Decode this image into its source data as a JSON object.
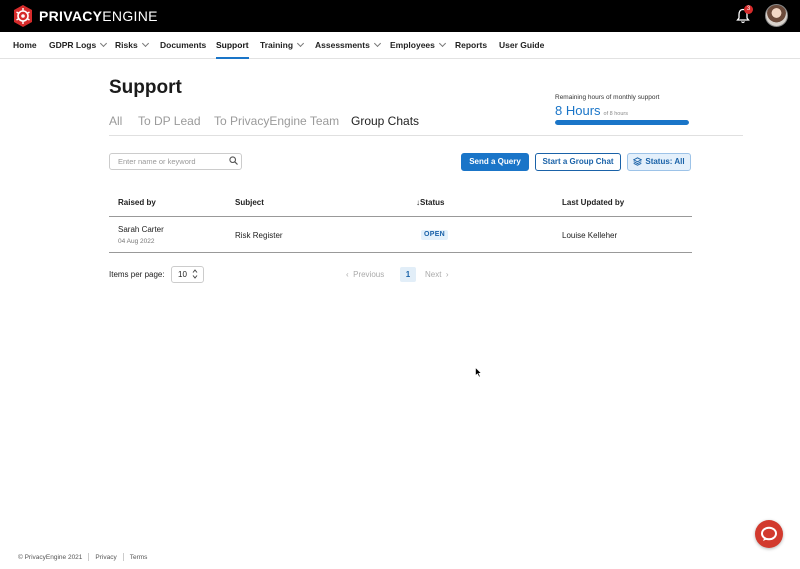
{
  "topbar": {
    "logo_text_bold": "PRIVACY",
    "logo_text_rest": "ENGINE",
    "notification_count": "3",
    "colors": {
      "background": "#000000",
      "logo": "#d62b2b"
    }
  },
  "nav": {
    "items": [
      {
        "label": "Home",
        "dropdown": false
      },
      {
        "label": "GDPR Logs",
        "dropdown": true
      },
      {
        "label": "Risks",
        "dropdown": true
      },
      {
        "label": "Documents",
        "dropdown": false
      },
      {
        "label": "Support",
        "dropdown": false,
        "active": true
      },
      {
        "label": "Training",
        "dropdown": true
      },
      {
        "label": "Assessments",
        "dropdown": true
      },
      {
        "label": "Employees",
        "dropdown": true
      },
      {
        "label": "Reports",
        "dropdown": false
      },
      {
        "label": "User Guide",
        "dropdown": false
      }
    ]
  },
  "page": {
    "title": "Support",
    "tabs": [
      "All",
      "To DP Lead",
      "To PrivacyEngine Team",
      "Group Chats"
    ],
    "active_tab": "Group Chats"
  },
  "support_hours": {
    "label": "Remaining hours of monthly support",
    "value": "8 Hours",
    "of_total": "of 8 hours",
    "remaining_fraction": 1.0
  },
  "toolbar": {
    "search_placeholder": "Enter name or keyword",
    "send_query_label": "Send a Query",
    "start_group_chat_label": "Start a Group Chat",
    "status_filter_label": "Status: All"
  },
  "table": {
    "headers": {
      "raised_by": "Raised by",
      "subject": "Subject",
      "status": "↓Status",
      "last_updated_by": "Last Updated by"
    },
    "rows": [
      {
        "raised_by": "Sarah Carter",
        "date": "04 Aug 2022",
        "subject": "Risk Register",
        "status": "OPEN",
        "last_updated_by": "Louise Kelleher"
      }
    ]
  },
  "pagination": {
    "items_per_page_label": "Items per page:",
    "items_per_page_value": "10",
    "previous_label": "Previous",
    "current_page": "1",
    "next_label": "Next"
  },
  "footer": {
    "copyright": "© PrivacyEngine 2021",
    "privacy_label": "Privacy",
    "terms_label": "Terms"
  },
  "icons": {
    "search": "search-icon",
    "bell": "bell-icon",
    "filter": "layers-icon",
    "chat": "chat-bubble-icon"
  }
}
